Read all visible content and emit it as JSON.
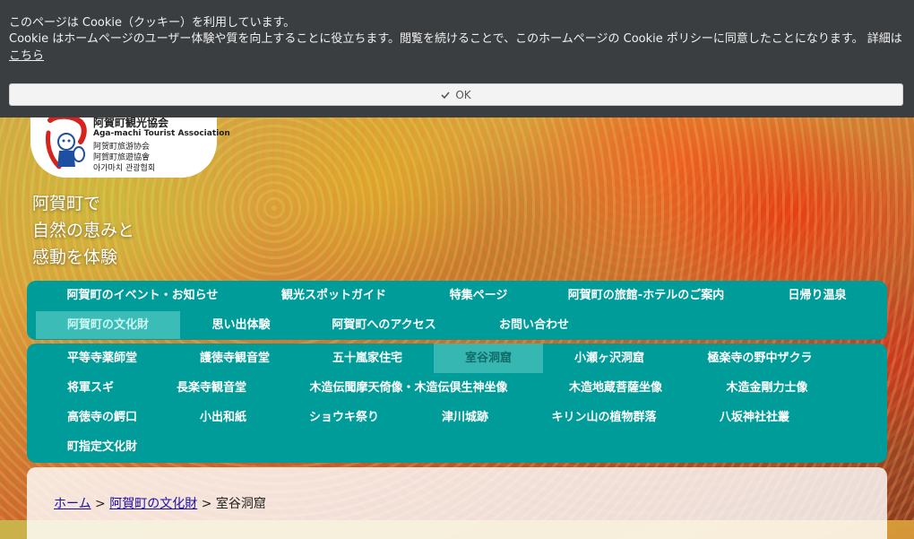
{
  "cookie": {
    "line1": "このページは Cookie（クッキー）を利用しています。",
    "line2": "Cookie はホームページのユーザー体験や質を向上することに役立ちます。閲覧を続けることで、このホームページの Cookie ポリシーに同意したことになります。 詳細は",
    "link": "こちら",
    "ok_label": "OK",
    "ok_icon": "check-icon"
  },
  "logo": {
    "title": "阿賀町観光協会",
    "english": "Aga-machi Tourist Association",
    "cn_simplified": "阿贺町旅游协会",
    "cn_traditional": "阿賀町旅遊協會",
    "korean": "아가마치 관광협회"
  },
  "tagline": [
    "阿賀町で",
    "自然の恵みと",
    "感動を体験"
  ],
  "main_nav": [
    {
      "label": "阿賀町のイベント・お知らせ"
    },
    {
      "label": "観光スポットガイド"
    },
    {
      "label": "特集ページ"
    },
    {
      "label": "阿賀町の旅館-ホテルのご案内"
    },
    {
      "label": "日帰り温泉"
    },
    {
      "label": "阿賀町の文化財",
      "active": true
    },
    {
      "label": "思い出体験"
    },
    {
      "label": "阿賀町へのアクセス"
    },
    {
      "label": "お問い合わせ"
    }
  ],
  "sub_nav": [
    {
      "label": "平等寺薬師堂"
    },
    {
      "label": "護徳寺観音堂"
    },
    {
      "label": "五十嵐家住宅"
    },
    {
      "label": "室谷洞窟",
      "active": true
    },
    {
      "label": "小瀬ヶ沢洞窟"
    },
    {
      "label": "極楽寺の野中ザクラ"
    },
    {
      "label": "将軍スギ"
    },
    {
      "label": "長楽寺観音堂"
    },
    {
      "label": "木造伝聞摩天倚像・木造伝倶生神坐像"
    },
    {
      "label": "木造地蔵菩薩坐像"
    },
    {
      "label": "木造金剛力士像"
    },
    {
      "label": "高徳寺の鰐口"
    },
    {
      "label": "小出和紙"
    },
    {
      "label": "ショウキ祭り"
    },
    {
      "label": "津川城跡"
    },
    {
      "label": "キリン山の植物群落"
    },
    {
      "label": "八坂神社社叢"
    },
    {
      "label": "町指定文化財"
    }
  ],
  "breadcrumb": {
    "home": "ホーム",
    "sep1": ">",
    "parent": "阿賀町の文化財",
    "sep2": ">",
    "current": "室谷洞窟"
  },
  "colors": {
    "nav_bg": "#009c99",
    "nav_active": "#3cbcb6",
    "cookie_bg": "#3b3e40"
  }
}
